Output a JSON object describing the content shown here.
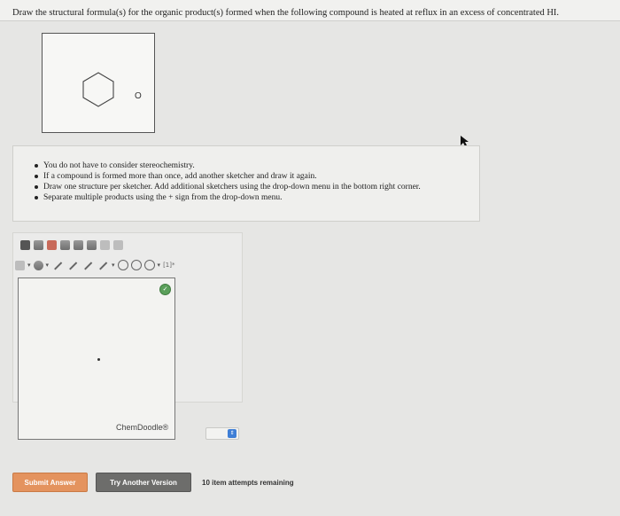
{
  "question": {
    "text": "Draw the structural formula(s) for the organic product(s) formed when the following compound is heated at reflux in an excess of concentrated HI."
  },
  "molecule": {
    "oxygen_label": "O"
  },
  "instructions": [
    "You do not have to consider stereochemistry.",
    "If a compound is formed more than once, add another sketcher and draw it again.",
    "Draw one structure per sketcher. Add additional sketchers using the drop-down menu in the bottom right corner.",
    "Separate multiple products using the + sign from the drop-down menu."
  ],
  "sketcher": {
    "toolbar_text": "[1]*",
    "watermark": "ChemDoodle®"
  },
  "buttons": {
    "submit": "Submit Answer",
    "try_another": "Try Another Version"
  },
  "attempts_text": "10 item attempts remaining",
  "colors": {
    "submit_bg": "#e4935e",
    "try_bg": "#6d6d6b",
    "chem_button": "#5a9f5a",
    "stepper_accent": "#3f7fd6"
  }
}
